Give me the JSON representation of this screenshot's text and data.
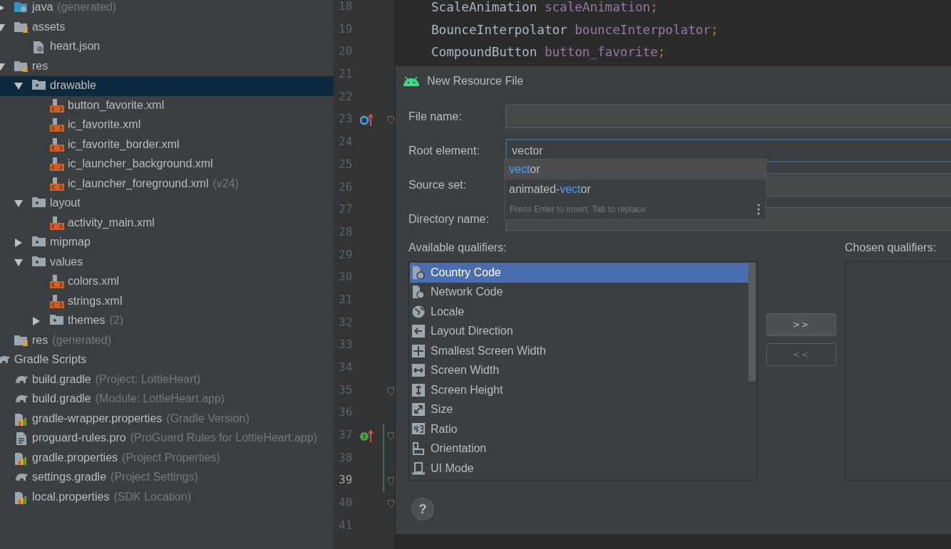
{
  "project_tree": {
    "module_children": [
      {
        "label": "java",
        "note": "(generated)",
        "kind": "java-folder",
        "expanded": false,
        "selected": false
      },
      {
        "label": "assets",
        "kind": "resource-folder",
        "expanded": true,
        "selected": false,
        "children": [
          {
            "label": "heart.json",
            "kind": "json-file",
            "selected": false
          }
        ]
      },
      {
        "label": "res",
        "kind": "resource-folder",
        "expanded": true,
        "selected": false,
        "children": [
          {
            "label": "drawable",
            "kind": "folder",
            "expanded": true,
            "selected": true,
            "children": [
              {
                "label": "button_favorite.xml",
                "kind": "xml-file",
                "selected": false
              },
              {
                "label": "ic_favorite.xml",
                "kind": "xml-file",
                "selected": false
              },
              {
                "label": "ic_favorite_border.xml",
                "kind": "xml-file",
                "selected": false
              },
              {
                "label": "ic_launcher_background.xml",
                "kind": "xml-file",
                "selected": false
              },
              {
                "label": "ic_launcher_foreground.xml",
                "note": "(v24)",
                "kind": "xml-file",
                "selected": false
              }
            ]
          },
          {
            "label": "layout",
            "kind": "folder",
            "expanded": true,
            "selected": false,
            "children": [
              {
                "label": "activity_main.xml",
                "kind": "xml-file",
                "selected": false
              }
            ]
          },
          {
            "label": "mipmap",
            "kind": "folder",
            "expanded": false,
            "selected": false
          },
          {
            "label": "values",
            "kind": "folder",
            "expanded": true,
            "selected": false,
            "children": [
              {
                "label": "colors.xml",
                "kind": "xml-file",
                "selected": false
              },
              {
                "label": "strings.xml",
                "kind": "xml-file",
                "selected": false
              },
              {
                "label": "themes",
                "note": "(2)",
                "kind": "folder",
                "expanded": false,
                "selected": false
              }
            ]
          }
        ]
      },
      {
        "label": "res",
        "note": "(generated)",
        "kind": "resource-folder",
        "selected": false
      }
    ],
    "roots": [
      {
        "label": "Gradle Scripts",
        "kind": "gradle",
        "selected": false,
        "children": [
          {
            "label": "build.gradle",
            "note": "(Project: LottieHeart)",
            "kind": "gradle",
            "selected": false
          },
          {
            "label": "build.gradle",
            "note": "(Module: LottieHeart.app)",
            "kind": "gradle",
            "selected": false
          },
          {
            "label": "gradle-wrapper.properties",
            "note": "(Gradle Version)",
            "kind": "properties",
            "selected": false
          },
          {
            "label": "proguard-rules.pro",
            "note": "(ProGuard Rules for LottieHeart.app)",
            "kind": "text-file",
            "selected": false
          },
          {
            "label": "gradle.properties",
            "note": "(Project Properties)",
            "kind": "properties",
            "selected": false
          },
          {
            "label": "settings.gradle",
            "note": "(Project Settings)",
            "kind": "gradle",
            "selected": false
          },
          {
            "label": "local.properties",
            "note": "(SDK Location)",
            "kind": "properties",
            "selected": false
          }
        ]
      }
    ]
  },
  "editor": {
    "lines": [
      {
        "number": "18",
        "tokens": [
          {
            "text": "ScaleAnimation",
            "kind": "type"
          },
          {
            "text": "scaleAnimation",
            "kind": "field"
          },
          {
            "text": ";",
            "kind": "punct"
          }
        ]
      },
      {
        "number": "19",
        "tokens": [
          {
            "text": "BounceInterpolator",
            "kind": "type"
          },
          {
            "text": "bounceInterpolator",
            "kind": "field"
          },
          {
            "text": ";",
            "kind": "punct"
          }
        ]
      },
      {
        "number": "20",
        "tokens": [
          {
            "text": "CompoundButton",
            "kind": "type"
          },
          {
            "text": "button_favorite",
            "kind": "field"
          },
          {
            "text": ";",
            "kind": "punct"
          }
        ]
      },
      {
        "number": "21"
      },
      {
        "number": "22"
      },
      {
        "number": "23",
        "kind": "overrides",
        "fold": true
      },
      {
        "number": "24"
      },
      {
        "number": "25"
      },
      {
        "number": "26"
      },
      {
        "number": "27"
      },
      {
        "number": "28"
      },
      {
        "number": "29"
      },
      {
        "number": "30"
      },
      {
        "number": "31"
      },
      {
        "number": "32"
      },
      {
        "number": "33"
      },
      {
        "number": "34"
      },
      {
        "number": "35",
        "fold": true
      },
      {
        "number": "36"
      },
      {
        "number": "37",
        "kind": "implements",
        "fold": true,
        "changed": true
      },
      {
        "number": "38",
        "changed": true
      },
      {
        "number": "39",
        "changed": true,
        "current": true,
        "fold": true
      },
      {
        "number": "40",
        "fold": true
      },
      {
        "number": "41"
      }
    ]
  },
  "dialog": {
    "title": "New Resource File",
    "fields": [
      {
        "label": "File name:",
        "focused": false
      },
      {
        "label": "Root element:",
        "value": "vector",
        "focused": true
      },
      {
        "label": "Source set:",
        "focused": false
      },
      {
        "label": "Directory name:",
        "focused": false
      }
    ],
    "completion": {
      "items": [
        {
          "selected": true,
          "segments": [
            {
              "text": "vect",
              "match": true
            },
            {
              "text": "or",
              "match": false
            }
          ]
        },
        {
          "selected": false,
          "segments": [
            {
              "text": "animated-",
              "match": false
            },
            {
              "text": "vect",
              "match": true
            },
            {
              "text": "or",
              "match": false
            }
          ]
        }
      ],
      "hint": "Press Enter to insert, Tab to replace"
    },
    "available_label": "Available qualifiers:",
    "qualifiers": [
      {
        "label": "Country Code",
        "kind": "sim",
        "selected": true
      },
      {
        "label": "Network Code",
        "kind": "sim",
        "selected": false
      },
      {
        "label": "Locale",
        "kind": "globe",
        "selected": false
      },
      {
        "label": "Layout Direction",
        "kind": "left-arrow",
        "selected": false
      },
      {
        "label": "Smallest Screen Width",
        "kind": "cross-arrows",
        "selected": false
      },
      {
        "label": "Screen Width",
        "kind": "horizontal-arrow",
        "selected": false
      },
      {
        "label": "Screen Height",
        "kind": "vertical-arrow",
        "selected": false
      },
      {
        "label": "Size",
        "kind": "diagonal-arrow",
        "selected": false
      },
      {
        "label": "Ratio",
        "kind": "ratio",
        "selected": false
      },
      {
        "label": "Orientation",
        "kind": "orientation",
        "selected": false
      },
      {
        "label": "UI Mode",
        "kind": "ui-mode",
        "selected": false
      }
    ],
    "buttons": [
      {
        "label": ">>",
        "disabled": false
      },
      {
        "label": "<<",
        "disabled": true
      }
    ],
    "chosen_label": "Chosen qualifiers:",
    "help": "?"
  }
}
